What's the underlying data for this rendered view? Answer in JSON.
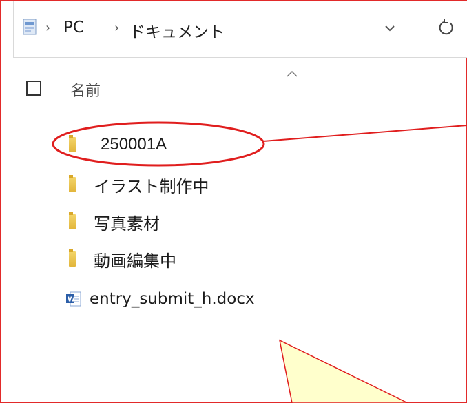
{
  "address_bar": {
    "breadcrumbs": [
      "PC",
      "ドキュメント"
    ],
    "location_icon": "folder-location-icon",
    "dropdown_icon": "chevron-down-icon",
    "refresh_icon": "refresh-icon"
  },
  "column_header": {
    "name_label": "名前",
    "sort_icon": "sort-ascending-caret-icon"
  },
  "items": [
    {
      "label": "250001A",
      "type": "folder"
    },
    {
      "label": "イラスト制作中",
      "type": "folder"
    },
    {
      "label": "写真素材",
      "type": "folder"
    },
    {
      "label": "動画編集中",
      "type": "folder"
    },
    {
      "label": "entry_submit_h.docx",
      "type": "word-document"
    }
  ],
  "annotation": {
    "highlight_color": "#e01e1e",
    "callout_fill": "#ffffcc"
  }
}
